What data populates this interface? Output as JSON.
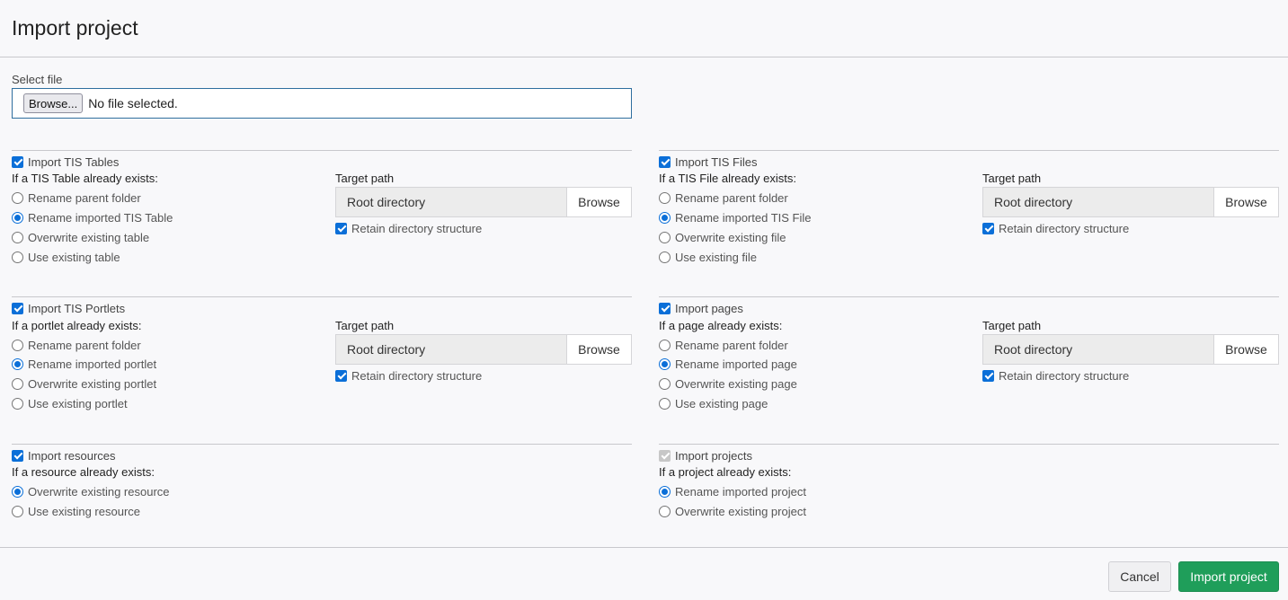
{
  "title": "Import project",
  "file": {
    "label": "Select file",
    "button": "Browse...",
    "status": "No file selected."
  },
  "tables": {
    "heading": "Import TIS Tables",
    "prompt": "If a TIS Table already exists:",
    "options": [
      "Rename parent folder",
      "Rename imported TIS Table",
      "Overwrite existing table",
      "Use existing table"
    ],
    "target_label": "Target path",
    "target_value": "Root directory",
    "browse": "Browse",
    "retain": "Retain directory structure"
  },
  "files": {
    "heading": "Import TIS Files",
    "prompt": "If a TIS File already exists:",
    "options": [
      "Rename parent folder",
      "Rename imported TIS File",
      "Overwrite existing file",
      "Use existing file"
    ],
    "target_label": "Target path",
    "target_value": "Root directory",
    "browse": "Browse",
    "retain": "Retain directory structure"
  },
  "portlets": {
    "heading": "Import TIS Portlets",
    "prompt": "If a portlet already exists:",
    "options": [
      "Rename parent folder",
      "Rename imported portlet",
      "Overwrite existing portlet",
      "Use existing portlet"
    ],
    "target_label": "Target path",
    "target_value": "Root directory",
    "browse": "Browse",
    "retain": "Retain directory structure"
  },
  "pages": {
    "heading": "Import pages",
    "prompt": "If a page already exists:",
    "options": [
      "Rename parent folder",
      "Rename imported page",
      "Overwrite existing page",
      "Use existing page"
    ],
    "target_label": "Target path",
    "target_value": "Root directory",
    "browse": "Browse",
    "retain": "Retain directory structure"
  },
  "resources": {
    "heading": "Import resources",
    "prompt": "If a resource already exists:",
    "options": [
      "Overwrite existing resource",
      "Use existing resource"
    ]
  },
  "projects": {
    "heading": "Import projects",
    "prompt": "If a project already exists:",
    "options": [
      "Rename imported project",
      "Overwrite existing project"
    ]
  },
  "footer": {
    "cancel": "Cancel",
    "import": "Import project"
  },
  "colors": {
    "accent": "#0b6fd8",
    "primary_button": "#1f9e5a",
    "focus_border": "#2f6f9f"
  }
}
